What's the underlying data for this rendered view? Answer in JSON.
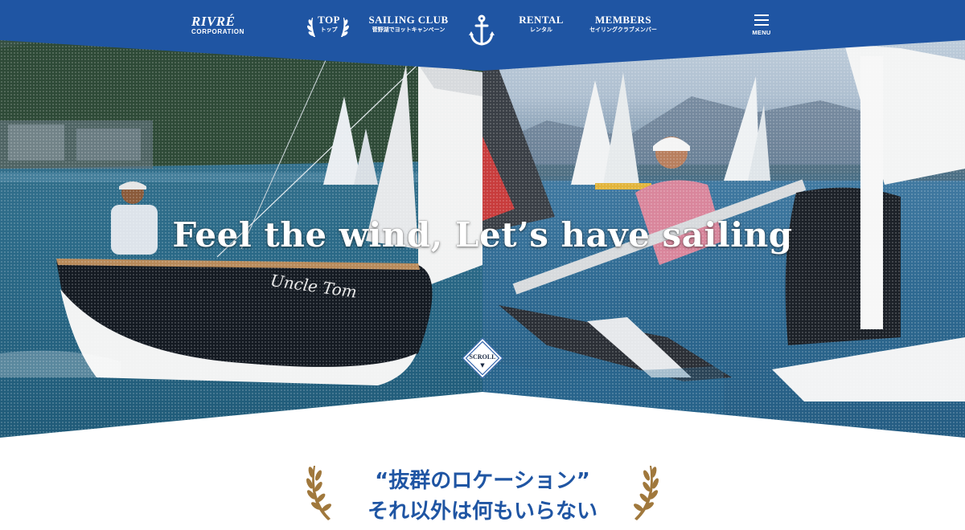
{
  "brand": {
    "name": "RIVRÉ",
    "sub": "CORPORATION"
  },
  "nav": [
    {
      "en": "TOP",
      "jp": "トップ"
    },
    {
      "en": "SAILING CLUB",
      "jp": "菅野湖でヨットキャンペーン"
    },
    {
      "en": "RENTAL",
      "jp": "レンタル"
    },
    {
      "en": "MEMBERS",
      "jp": "セイリングクラブメンバー"
    }
  ],
  "menu_label": "MENU",
  "hero": {
    "tagline": "Feel the wind, Let’s have sailing",
    "boat_name": "Uncle Tom",
    "scroll_label": "SCROLL",
    "scroll_arrow": "▼"
  },
  "intro": {
    "line1": "“抜群のロケーション”",
    "line2": "それ以外は何もいらない"
  },
  "colors": {
    "brand_blue": "#1f55a3",
    "laurel_gold": "#a0783c",
    "white": "#ffffff"
  },
  "icons": [
    "laurel-icon",
    "anchor-icon",
    "hamburger-icon",
    "scroll-arrow-icon"
  ]
}
